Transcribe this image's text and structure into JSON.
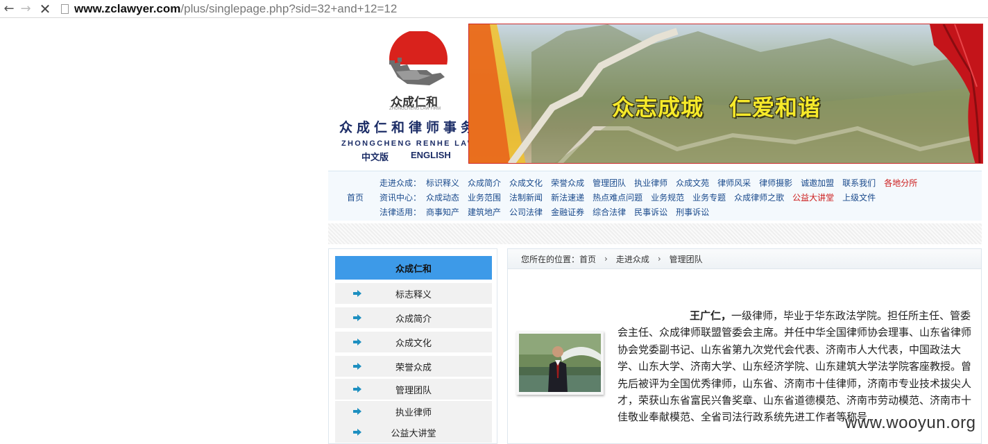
{
  "browser": {
    "url_host": "www.zclawyer.com",
    "url_path": "/plus/singlepage.php?sid=32+and+12=12"
  },
  "header": {
    "logo_cn": "众成仁和",
    "logo_small": "ZHONGCHENG LAW FIRM",
    "firm_name_cn": "众成仁和律师事务所",
    "firm_name_en": "ZHONGCHENG RENHE LAW FIRM",
    "lang_cn": "中文版",
    "lang_en": "ENGLISH",
    "slogan_1": "众志成城",
    "slogan_2": "仁爱和谐"
  },
  "nav": {
    "home": "首页",
    "rows": [
      {
        "category": "走进众成：",
        "links": [
          "标识释义",
          "众成简介",
          "众成文化",
          "荣誉众成",
          "管理团队",
          "执业律师",
          "众成文苑",
          "律师风采",
          "律师摄影",
          "诚邀加盟",
          "联系我们",
          "各地分所"
        ]
      },
      {
        "category": "资讯中心：",
        "links": [
          "众成动态",
          "业务范围",
          "法制新闻",
          "新法速递",
          "热点难点问题",
          "业务规范",
          "业务专题",
          "众成律师之歌",
          "公益大讲堂",
          "上级文件"
        ]
      },
      {
        "category": "法律适用：",
        "links": [
          "商事知产",
          "建筑地产",
          "公司法律",
          "金融证券",
          "综合法律",
          "民事诉讼",
          "刑事诉讼"
        ]
      }
    ],
    "red_links": [
      "各地分所",
      "公益大讲堂"
    ]
  },
  "sidebar": {
    "title": "众成仁和",
    "items": [
      "标志释义",
      "众成简介",
      "众成文化",
      "荣誉众成",
      "管理团队",
      "执业律师",
      "公益大讲堂"
    ]
  },
  "breadcrumb": {
    "prefix": "您所在的位置：",
    "items": [
      "首页",
      "走进众成",
      "管理团队"
    ]
  },
  "bio": {
    "name": "王广仁，",
    "text": "一级律师，毕业于华东政法学院。担任所主任、管委会主任、众成律师联盟管委会主席。并任中华全国律师协会理事、山东省律师协会党委副书记、山东省第九次党代会代表、济南市人大代表，中国政法大学、山东大学、济南大学、山东经济学院、山东建筑大学法学院客座教授。曾先后被评为全国优秀律师，山东省、济南市十佳律师，济南市专业技术拔尖人才，荣获山东省富民兴鲁奖章、山东省道德模范、济南市劳动模范、济南市十佳敬业奉献模范、全省司法行政系统先进工作者等称号.."
  },
  "watermark": "www.wooyun.org",
  "colors": {
    "accent": "#3d9ae8",
    "nav_link": "#1a4a8c",
    "nav_red": "#cc1a1a",
    "slogan": "#f7ea2a",
    "logo_red": "#d9221c"
  }
}
